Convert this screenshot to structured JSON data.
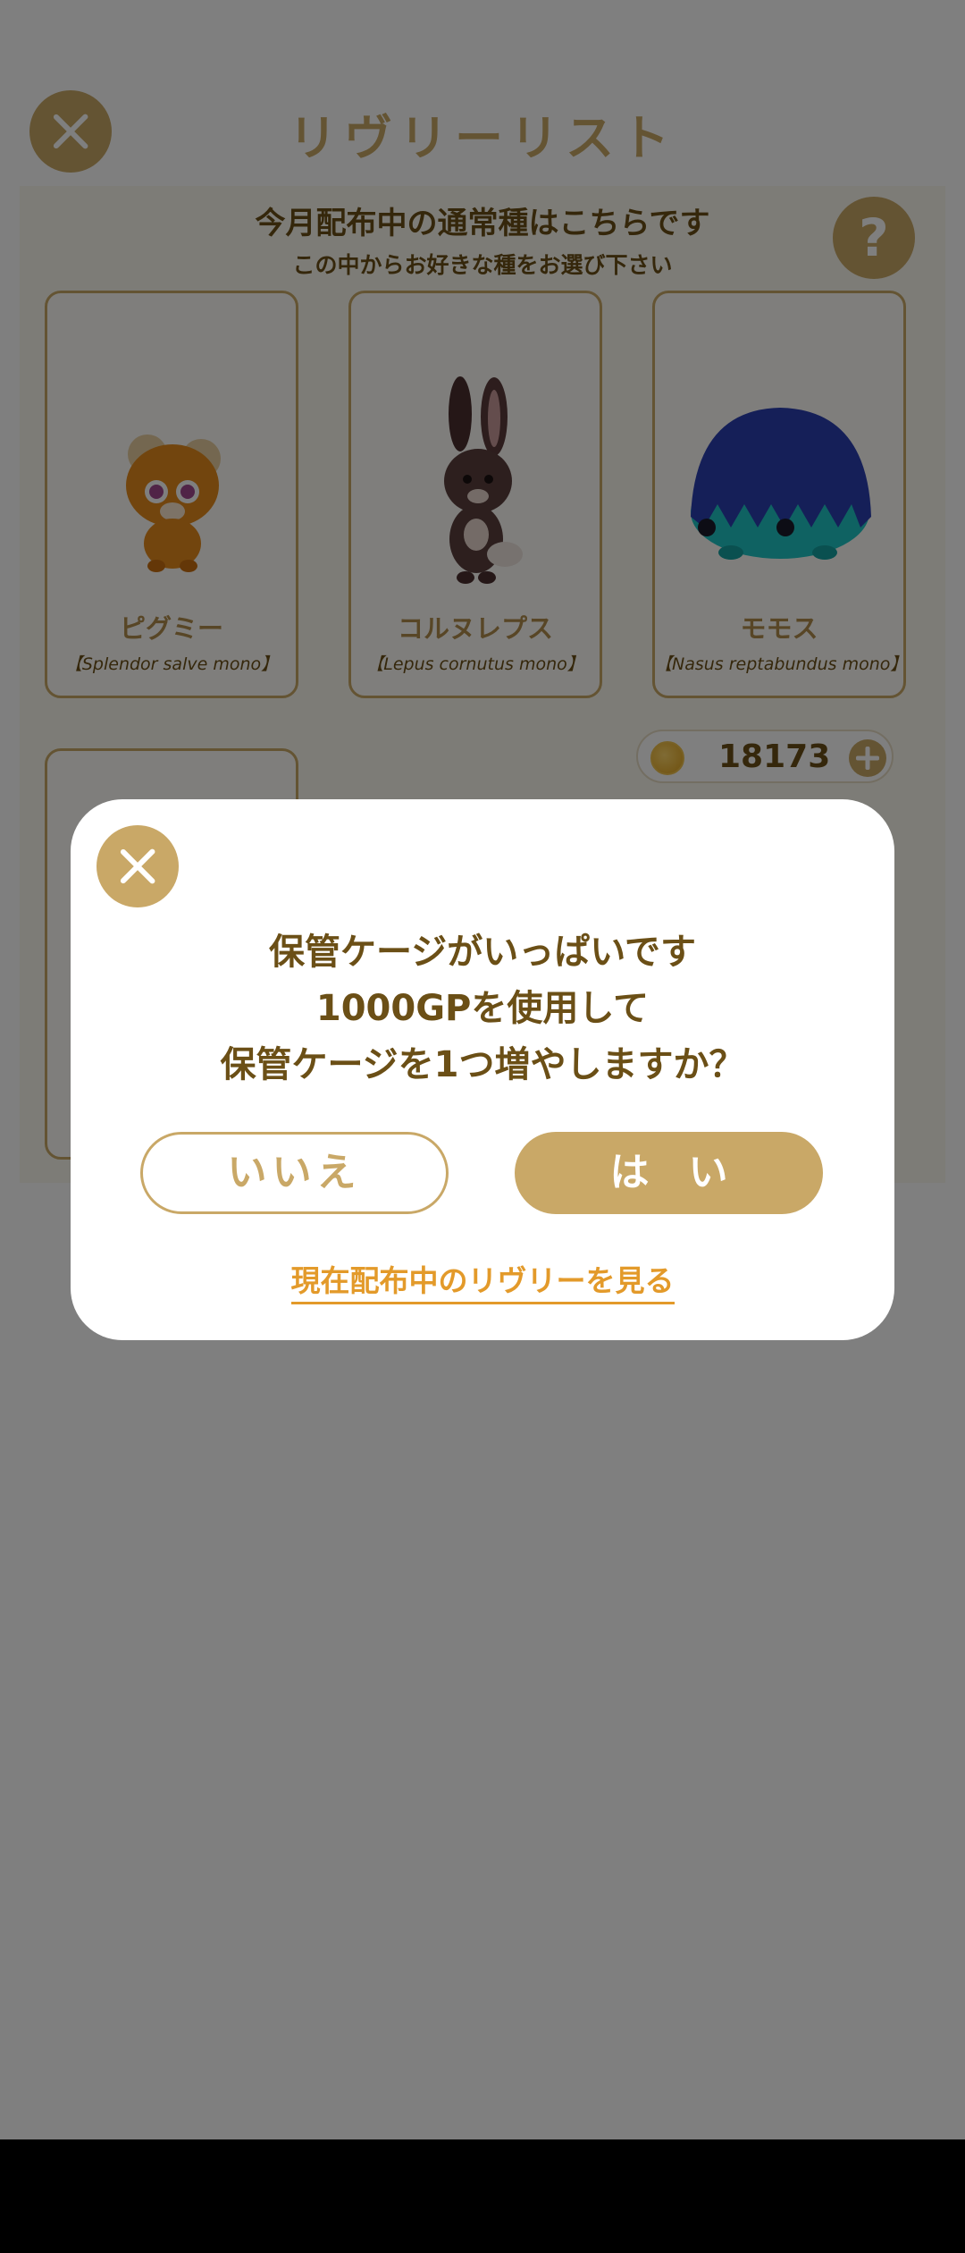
{
  "header": {
    "title": "リヴリーリスト"
  },
  "panel": {
    "heading": "今月配布中の通常種はこちらです",
    "subheading": "この中からお好きな種をお選び下さい",
    "help_label": "?",
    "cards": [
      {
        "name": "ピグミー",
        "scientific": "【Splendor salve mono】"
      },
      {
        "name": "コルヌレプス",
        "scientific": "【Lepus cornutus mono】"
      },
      {
        "name": "モモス",
        "scientific": "【Nasus reptabundus mono】"
      }
    ]
  },
  "wallet": {
    "gp": "18173"
  },
  "dialog": {
    "message_lines": [
      "保管ケージがいっぱいです",
      "1000GPを使用して",
      "保管ケージを1つ増やしますか？"
    ],
    "no_label": "いいえ",
    "yes_label": "は　い",
    "link_label": "現在配布中のリヴリーを見る"
  },
  "colors": {
    "accent": "#c9a867",
    "text_brown": "#6b4f16",
    "link_orange": "#e39a2a",
    "overlay": "rgba(0,0,0,0.5)"
  }
}
